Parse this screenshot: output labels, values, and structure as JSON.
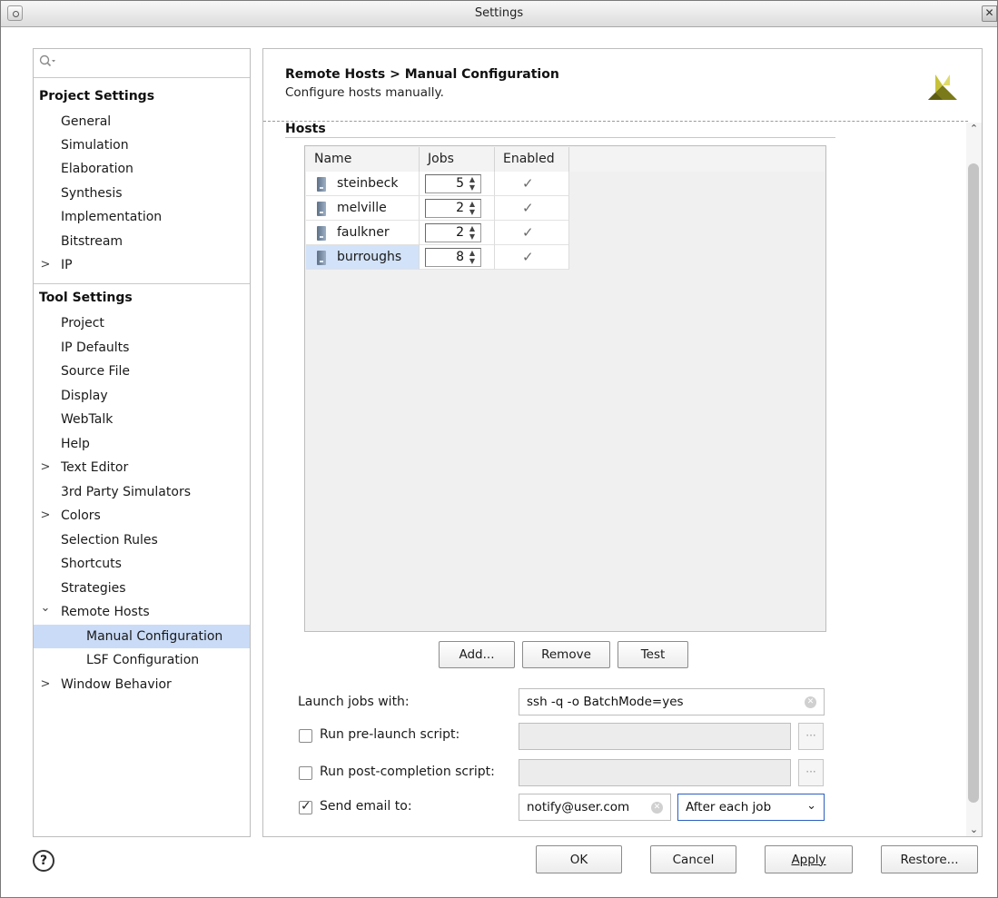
{
  "window": {
    "title": "Settings"
  },
  "sidebar": {
    "search_placeholder": "",
    "project_settings": {
      "header": "Project Settings",
      "items": [
        {
          "label": "General",
          "expandable": false
        },
        {
          "label": "Simulation",
          "expandable": false
        },
        {
          "label": "Elaboration",
          "expandable": false
        },
        {
          "label": "Synthesis",
          "expandable": false
        },
        {
          "label": "Implementation",
          "expandable": false
        },
        {
          "label": "Bitstream",
          "expandable": false
        },
        {
          "label": "IP",
          "expandable": true
        }
      ]
    },
    "tool_settings": {
      "header": "Tool Settings",
      "items": [
        {
          "label": "Project"
        },
        {
          "label": "IP Defaults"
        },
        {
          "label": "Source File"
        },
        {
          "label": "Display"
        },
        {
          "label": "WebTalk"
        },
        {
          "label": "Help"
        },
        {
          "label": "Text Editor"
        },
        {
          "label": "3rd Party Simulators"
        },
        {
          "label": "Colors"
        },
        {
          "label": "Selection Rules"
        },
        {
          "label": "Shortcuts"
        },
        {
          "label": "Strategies"
        },
        {
          "label": "Remote Hosts"
        },
        {
          "label": "Manual Configuration"
        },
        {
          "label": "LSF Configuration"
        },
        {
          "label": "Window Behavior"
        }
      ],
      "chevron_collapsed": ">",
      "chevron_expanded": "⌄"
    }
  },
  "panel": {
    "breadcrumb": "Remote Hosts > Manual Configuration",
    "subtitle": "Configure hosts manually.",
    "section_title": "Hosts",
    "table": {
      "columns": [
        "Name",
        "Jobs",
        "Enabled"
      ],
      "rows": [
        {
          "name": "steinbeck",
          "jobs": "5",
          "enabled": true
        },
        {
          "name": "melville",
          "jobs": "2",
          "enabled": true
        },
        {
          "name": "faulkner",
          "jobs": "2",
          "enabled": true
        },
        {
          "name": "burroughs",
          "jobs": "8",
          "enabled": true
        }
      ]
    },
    "buttons": {
      "add": "Add...",
      "remove": "Remove",
      "test": "Test"
    },
    "launch_jobs": {
      "label": "Launch jobs with:",
      "value": "ssh -q -o BatchMode=yes"
    },
    "pre_launch": {
      "label": "Run pre-launch script:",
      "checked": false,
      "value": ""
    },
    "post_completion": {
      "label": "Run post-completion script:",
      "checked": false,
      "value": ""
    },
    "send_email": {
      "label": "Send email to:",
      "checked": true,
      "value": "notify@user.com",
      "frequency": "After each job"
    }
  },
  "footer": {
    "help": "?",
    "ok": "OK",
    "cancel": "Cancel",
    "apply": "Apply",
    "restore": "Restore..."
  },
  "icons": {
    "search": "search-icon",
    "host": "server-icon",
    "close": "close-icon",
    "clear": "clear-icon",
    "browse": "ellipsis-icon"
  },
  "colors": {
    "selection": "#c9dbf6",
    "accent": "#2c5fbf",
    "logo_dark": "#7a7a1a",
    "logo_light": "#c7c23a"
  }
}
